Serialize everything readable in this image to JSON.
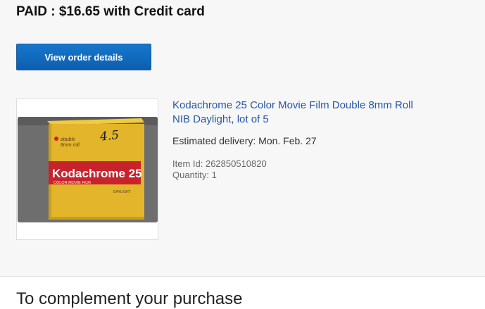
{
  "payment": {
    "summary": "PAID : $16.65 with Credit card"
  },
  "actions": {
    "view_order_label": "View order details"
  },
  "item": {
    "title": "Kodachrome 25 Color Movie Film Double 8mm Roll NIB Daylight, lot of 5",
    "delivery": "Estimated delivery: Mon. Feb. 27",
    "item_id": "Item Id: 262850510820",
    "quantity": "Quantity: 1",
    "image": {
      "brand": "Kodachrome 25",
      "subtitle": "COLOR MOVIE FILM",
      "format_line1": "double",
      "format_line2": "8mm roll",
      "daylight": "DAYLIGHT",
      "handwriting": "4.5"
    }
  },
  "section": {
    "complement_heading": "To complement your purchase"
  },
  "colors": {
    "link": "#2457a4",
    "button": "#0d5eae",
    "panel_bg": "#f7f7f7",
    "box_yellow": "#e2b52a",
    "label_red": "#c8232c"
  }
}
